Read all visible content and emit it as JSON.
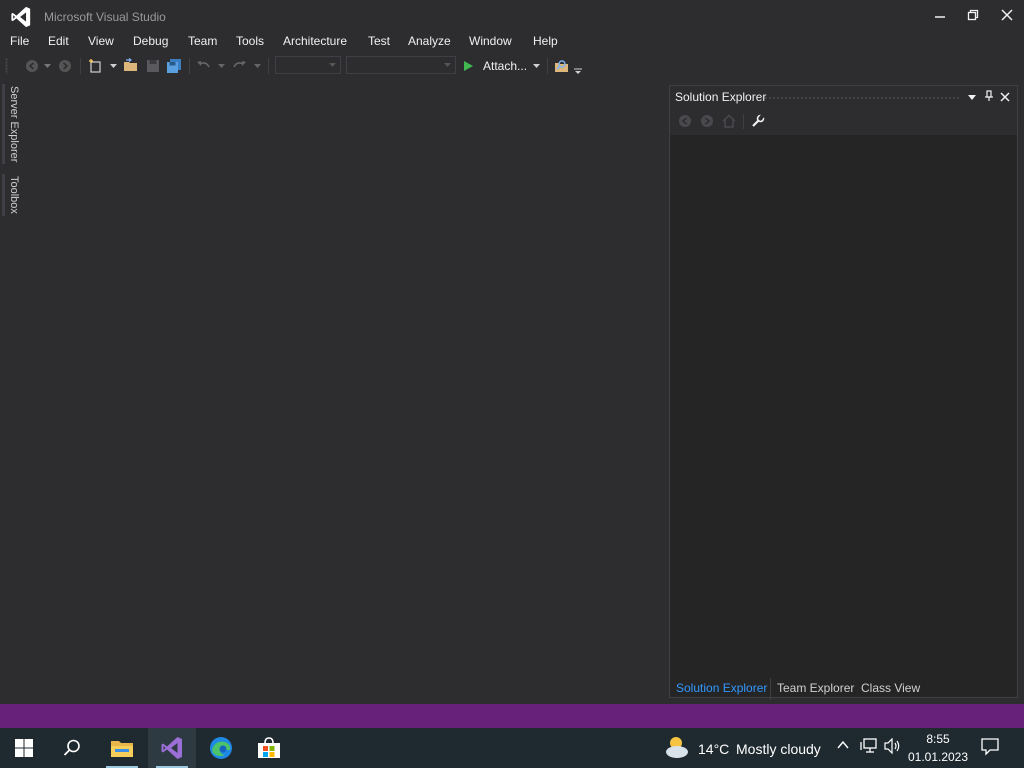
{
  "window": {
    "title": "Microsoft Visual Studio"
  },
  "menu": {
    "items": [
      "File",
      "Edit",
      "View",
      "Debug",
      "Team",
      "Tools",
      "Architecture",
      "Test",
      "Analyze",
      "Window",
      "Help"
    ]
  },
  "toolbar": {
    "attach_label": "Attach..."
  },
  "side_tabs": {
    "server_explorer": "Server Explorer",
    "toolbox": "Toolbox"
  },
  "solution_explorer": {
    "title": "Solution Explorer",
    "tabs": [
      {
        "label": "Solution Explorer",
        "active": true
      },
      {
        "label": "Team Explorer",
        "active": false
      },
      {
        "label": "Class View",
        "active": false
      }
    ]
  },
  "colors": {
    "background": "#2d2d30",
    "status_bar": "#68217a",
    "active_tab": "#3399ff",
    "vs_purple": "#9b6fd6",
    "taskbar": "#1f2a30"
  },
  "taskbar": {
    "weather_temp": "14°C",
    "weather_desc": "Mostly cloudy",
    "time": "8:55",
    "date": "01.01.2023"
  }
}
